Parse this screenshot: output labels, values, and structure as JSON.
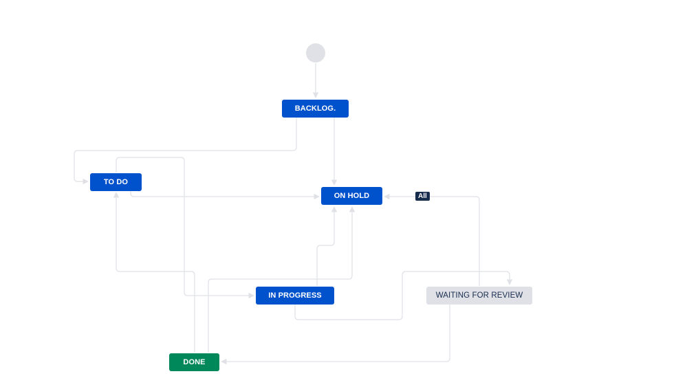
{
  "workflow": {
    "statuses": {
      "backlog": {
        "label": "BACKLOG.",
        "category": "blue"
      },
      "todo": {
        "label": "TO DO",
        "category": "blue"
      },
      "on_hold": {
        "label": "ON HOLD",
        "category": "blue"
      },
      "in_progress": {
        "label": "IN PROGRESS",
        "category": "blue"
      },
      "waiting_for_review": {
        "label": "WAITING FOR REVIEW",
        "category": "grey"
      },
      "done": {
        "label": "DONE",
        "category": "green"
      }
    },
    "all_badge": "All",
    "transitions": [
      {
        "from": "start",
        "to": "backlog"
      },
      {
        "from": "backlog",
        "to": "todo"
      },
      {
        "from": "backlog",
        "to": "on_hold"
      },
      {
        "from": "todo",
        "to": "on_hold"
      },
      {
        "from": "todo",
        "to": "in_progress"
      },
      {
        "from": "in_progress",
        "to": "on_hold"
      },
      {
        "from": "in_progress",
        "to": "waiting_for_review"
      },
      {
        "from": "waiting_for_review",
        "to": "on_hold"
      },
      {
        "from": "waiting_for_review",
        "to": "done"
      },
      {
        "from": "done",
        "to": "todo"
      },
      {
        "from": "done",
        "to": "on_hold"
      }
    ]
  },
  "colors": {
    "status_blue": "#0052cc",
    "status_green": "#00875a",
    "status_grey": "#dfe1e6",
    "edge": "#dfe1e6",
    "badge": "#172b4d"
  }
}
